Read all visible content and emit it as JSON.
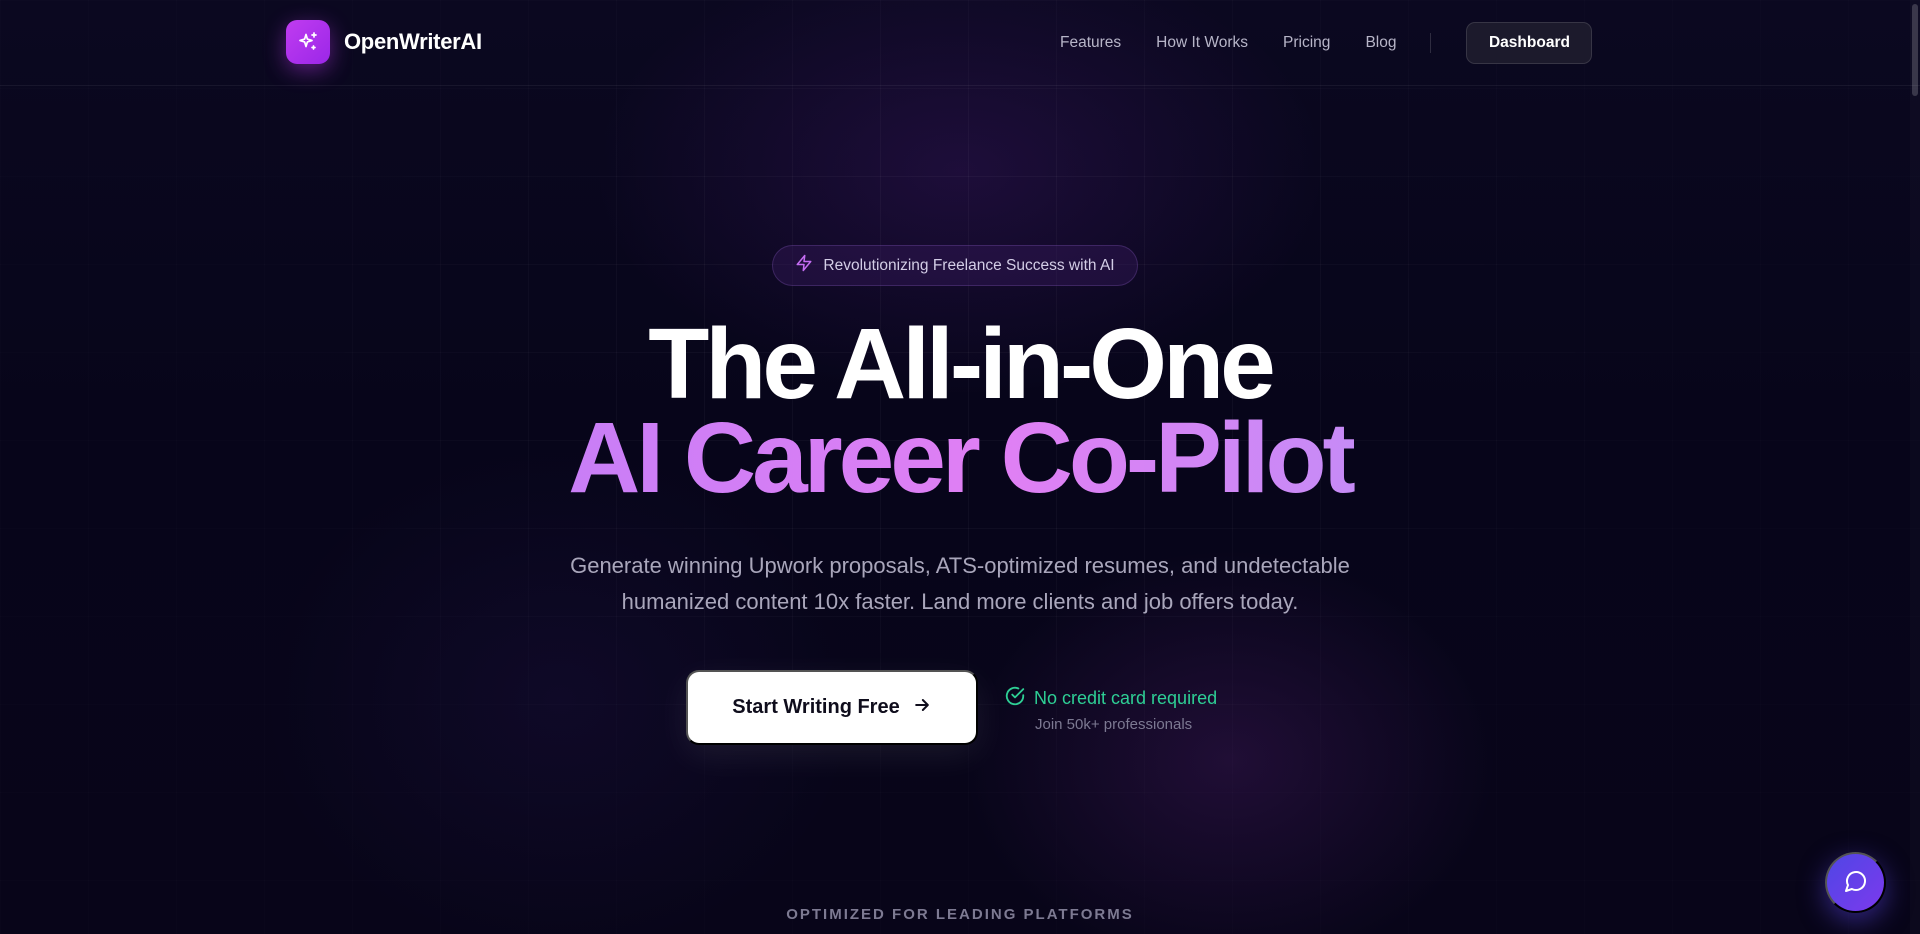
{
  "brand": {
    "name": "OpenWriterAI",
    "logo_icon": "sparkles-icon",
    "accent": "#b334ee"
  },
  "nav": {
    "links": [
      {
        "label": "Features"
      },
      {
        "label": "How It Works"
      },
      {
        "label": "Pricing"
      },
      {
        "label": "Blog"
      }
    ],
    "dashboard_label": "Dashboard"
  },
  "hero": {
    "badge_icon": "zap-icon",
    "badge_text": "Revolutionizing Freelance Success with AI",
    "title_line1": "The All-in-One",
    "title_line2": "AI Career Co-Pilot",
    "subtitle_line1": "Generate winning Upwork proposals, ATS-optimized resumes, and undetectable",
    "subtitle_line2": "humanized content 10x faster. Land more clients and job offers today.",
    "cta_label": "Start Writing Free",
    "cta_icon": "arrow-right-icon",
    "trust_icon": "check-circle-icon",
    "trust_title": "No credit card required",
    "trust_sub": "Join 50k+ professionals",
    "trust_color": "#2ecf95"
  },
  "platforms": {
    "heading": "OPTIMIZED FOR LEADING PLATFORMS"
  },
  "chat": {
    "icon": "chat-bubble-icon"
  }
}
